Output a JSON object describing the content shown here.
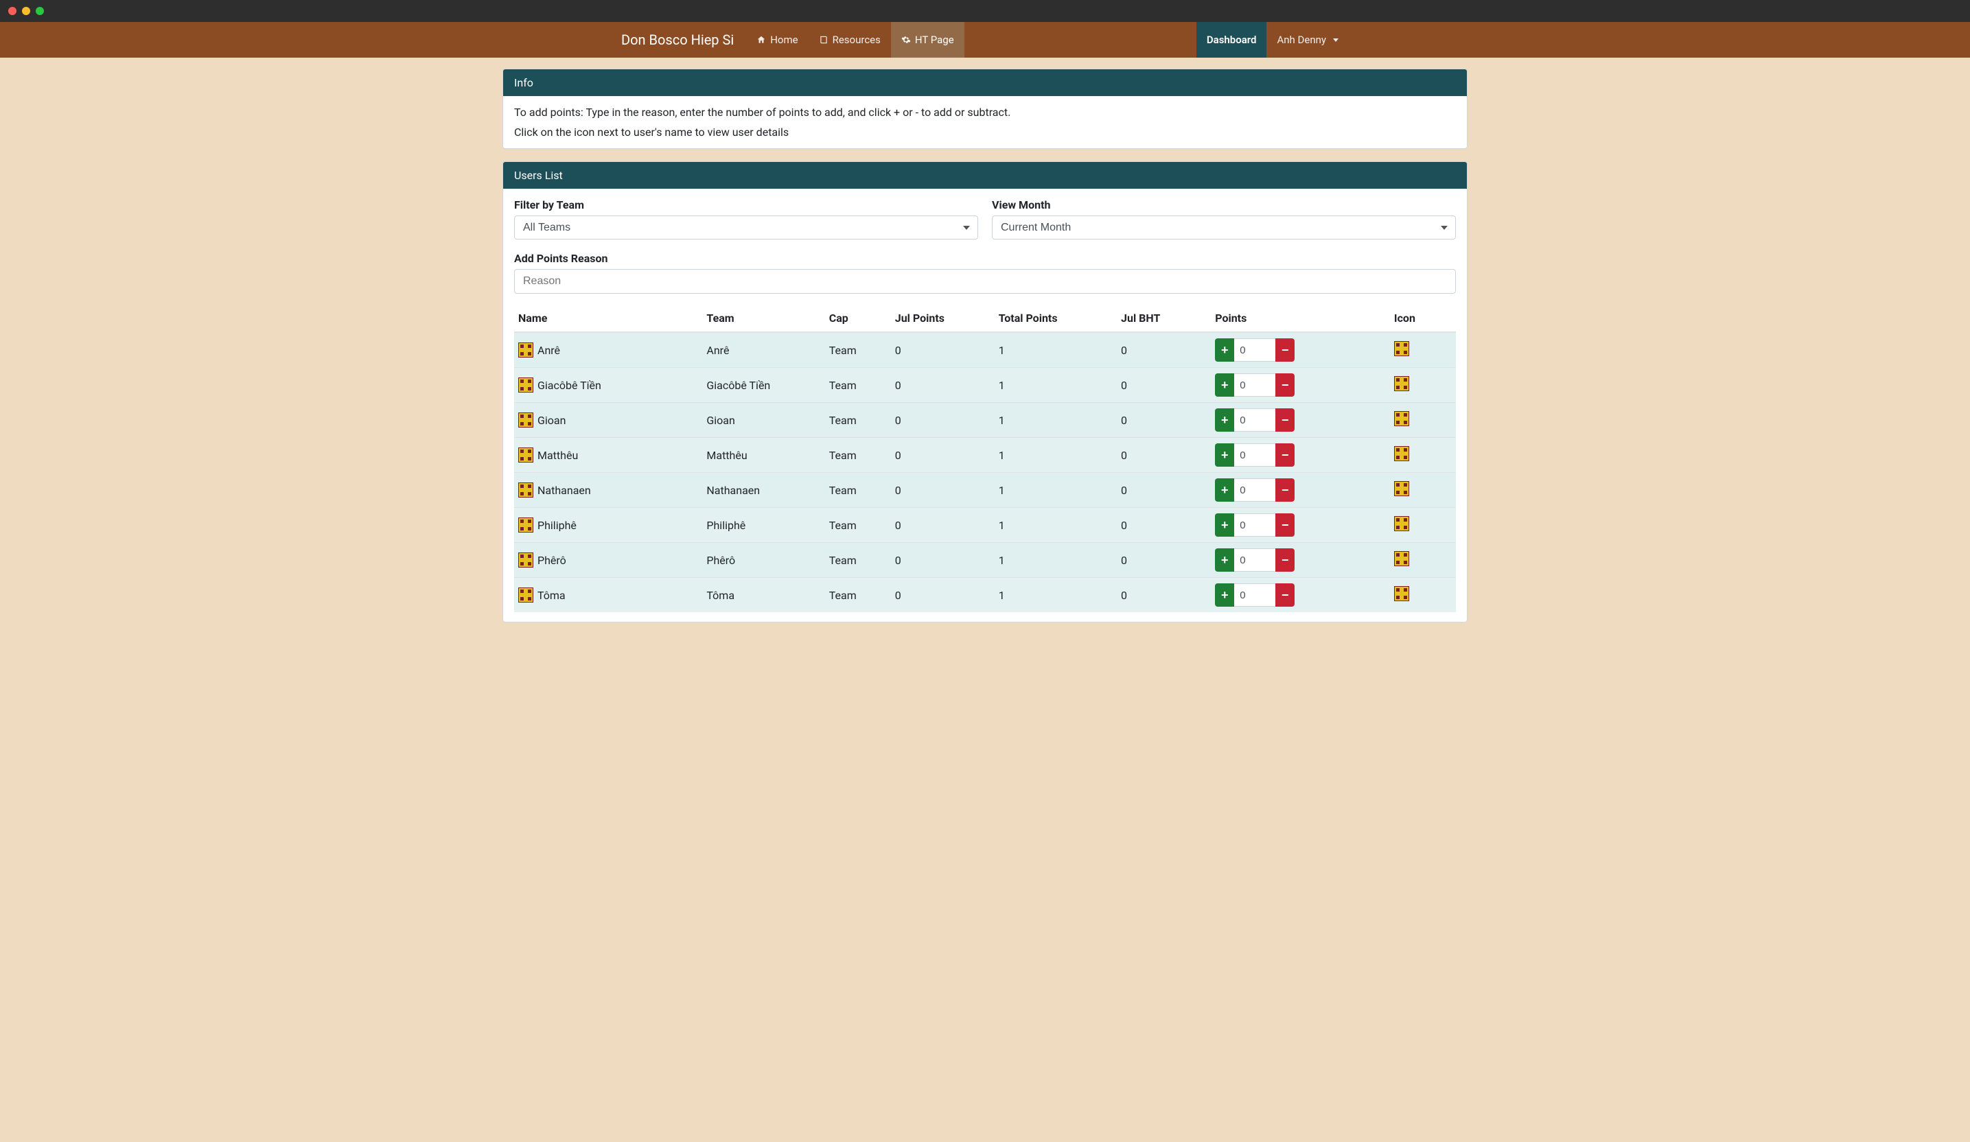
{
  "brand": "Don Bosco Hiep Si",
  "nav": {
    "home": "Home",
    "resources": "Resources",
    "htpage": "HT Page",
    "dashboard": "Dashboard",
    "user": "Anh Denny"
  },
  "info": {
    "header": "Info",
    "line1": "To add points: Type in the reason, enter the number of points to add, and click + or - to add or subtract.",
    "line2": "Click on the icon next to user's name to view user details"
  },
  "usersList": {
    "header": "Users List",
    "filterTeamLabel": "Filter by Team",
    "filterTeamValue": "All Teams",
    "viewMonthLabel": "View Month",
    "viewMonthValue": "Current Month",
    "reasonLabel": "Add Points Reason",
    "reasonPlaceholder": "Reason",
    "columns": {
      "name": "Name",
      "team": "Team",
      "cap": "Cap",
      "julPoints": "Jul Points",
      "totalPoints": "Total Points",
      "julBht": "Jul BHT",
      "points": "Points",
      "icon": "Icon"
    },
    "rows": [
      {
        "name": "Anrê",
        "team": "Anrê",
        "cap": "Team",
        "julPoints": "0",
        "totalPoints": "1",
        "julBht": "0",
        "pointsVal": "0"
      },
      {
        "name": "Giacôbê Tiền",
        "team": "Giacôbê Tiền",
        "cap": "Team",
        "julPoints": "0",
        "totalPoints": "1",
        "julBht": "0",
        "pointsVal": "0"
      },
      {
        "name": "Gioan",
        "team": "Gioan",
        "cap": "Team",
        "julPoints": "0",
        "totalPoints": "1",
        "julBht": "0",
        "pointsVal": "0"
      },
      {
        "name": "Matthêu",
        "team": "Matthêu",
        "cap": "Team",
        "julPoints": "0",
        "totalPoints": "1",
        "julBht": "0",
        "pointsVal": "0"
      },
      {
        "name": "Nathanaen",
        "team": "Nathanaen",
        "cap": "Team",
        "julPoints": "0",
        "totalPoints": "1",
        "julBht": "0",
        "pointsVal": "0"
      },
      {
        "name": "Philiphê",
        "team": "Philiphê",
        "cap": "Team",
        "julPoints": "0",
        "totalPoints": "1",
        "julBht": "0",
        "pointsVal": "0"
      },
      {
        "name": "Phêrô",
        "team": "Phêrô",
        "cap": "Team",
        "julPoints": "0",
        "totalPoints": "1",
        "julBht": "0",
        "pointsVal": "0"
      },
      {
        "name": "Tôma",
        "team": "Tôma",
        "cap": "Team",
        "julPoints": "0",
        "totalPoints": "1",
        "julBht": "0",
        "pointsVal": "0"
      }
    ]
  }
}
